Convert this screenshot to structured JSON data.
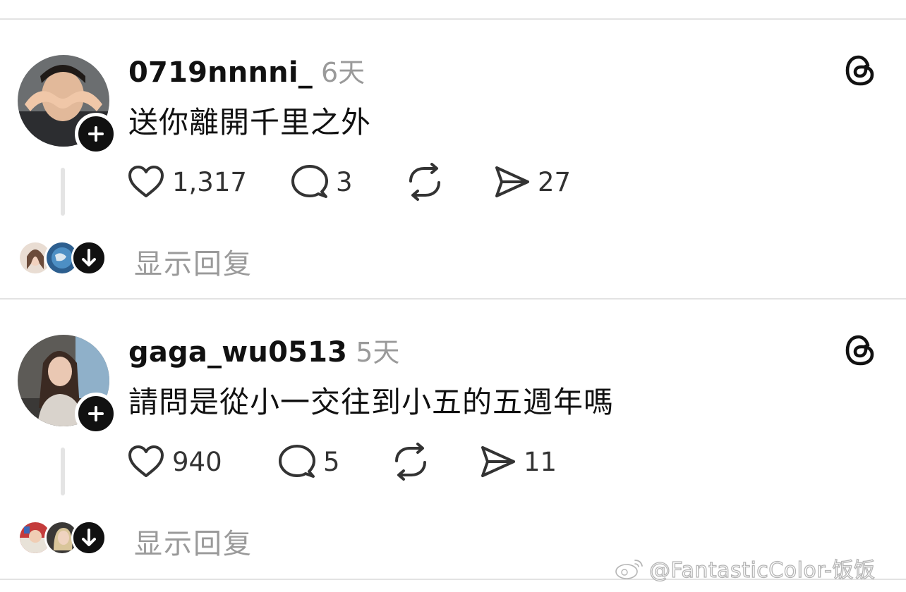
{
  "posts": [
    {
      "username": "0719nnnni_",
      "time": "6天",
      "text": "送你離開千里之外",
      "likes": "1,317",
      "comments": "3",
      "shares": "27",
      "show_replies": "显示回复",
      "avatar_icon": "user-avatar-photo",
      "follow_icon": "plus-icon"
    },
    {
      "username": "gaga_wu0513",
      "time": "5天",
      "text": "請問是從小一交往到小五的五週年嗎",
      "likes": "940",
      "comments": "5",
      "shares": "11",
      "show_replies": "显示回复",
      "avatar_icon": "user-avatar-photo",
      "follow_icon": "plus-icon"
    }
  ],
  "icons": {
    "like": "heart-icon",
    "comment": "comment-bubble-icon",
    "repost": "repost-icon",
    "share": "paper-plane-icon",
    "threads": "threads-logo-icon",
    "expand": "arrow-down-icon"
  },
  "watermark": "@FantasticColor-饭饭",
  "colors": {
    "text": "#111111",
    "muted": "#9a9a9a",
    "divider": "#e3e3e3",
    "badge": "#111111"
  }
}
